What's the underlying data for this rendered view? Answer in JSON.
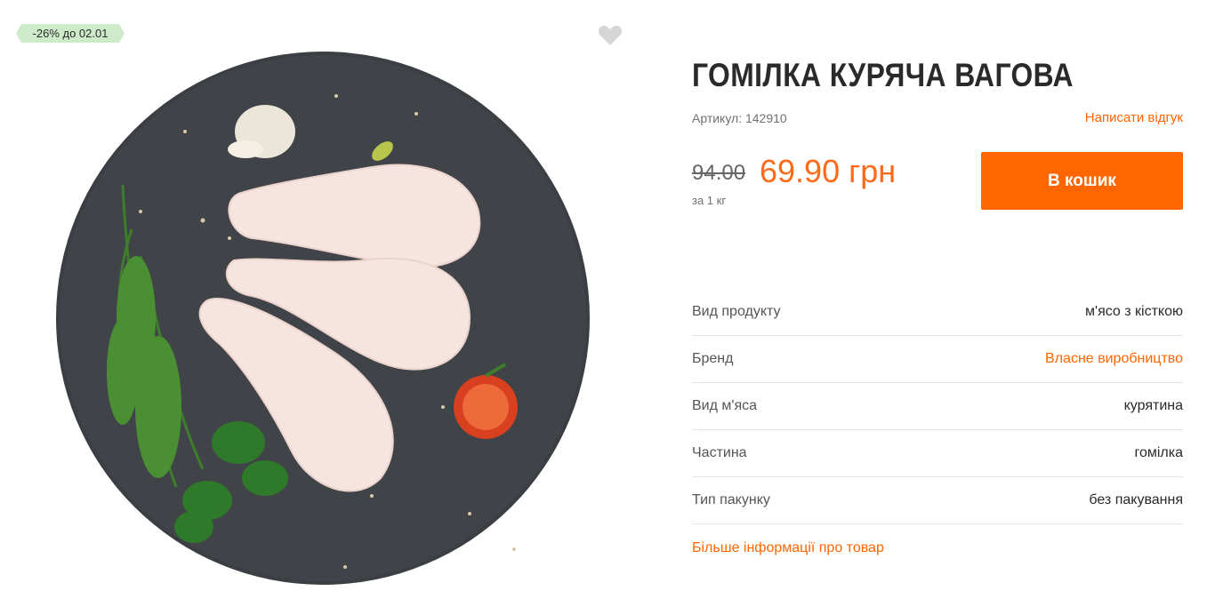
{
  "badge": {
    "text": "-26% до 02.01",
    "color": "#cdebc8"
  },
  "favorite": {
    "icon": "heart-icon",
    "color": "#d6d6d6"
  },
  "product": {
    "title": "ГОМІЛКА КУРЯЧА ВАГОВА",
    "sku": "Артикул: 142910",
    "review_link": "Написати відгук",
    "old_price": "94.00",
    "new_price": "69.90 грн",
    "unit": "за 1 кг",
    "cart_button": "В кошик"
  },
  "specs": [
    {
      "label": "Вид продукту",
      "value": "м'ясо з кісткою",
      "is_link": false
    },
    {
      "label": "Бренд",
      "value": "Власне виробництво",
      "is_link": true
    },
    {
      "label": "Вид м'яса",
      "value": "курятина",
      "is_link": false
    },
    {
      "label": "Частина",
      "value": "гомілка",
      "is_link": false
    },
    {
      "label": "Тип пакунку",
      "value": "без пакування",
      "is_link": false
    }
  ],
  "more_info_link": "Більше інформації про товар",
  "colors": {
    "accent": "#ff6600",
    "price": "#ff6a1a",
    "plate": "#3b3e42"
  }
}
